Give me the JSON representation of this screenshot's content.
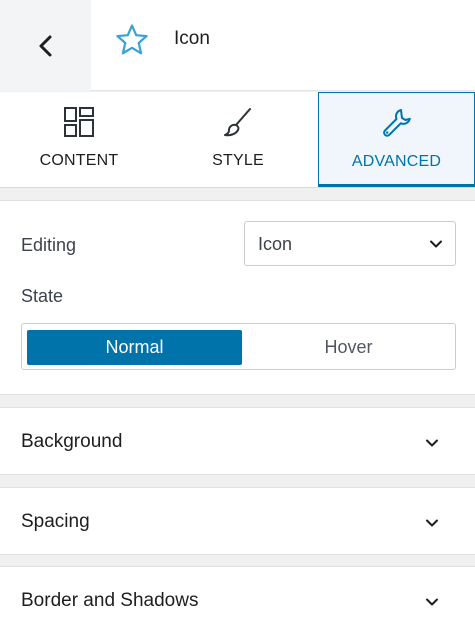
{
  "header": {
    "title": "Icon",
    "back_icon": "chevron-left-icon",
    "block_icon": "star-icon",
    "accent": "#3aa0d8"
  },
  "tabs": [
    {
      "label": "CONTENT",
      "icon": "layout-icon",
      "active": false
    },
    {
      "label": "STYLE",
      "icon": "brush-icon",
      "active": false
    },
    {
      "label": "ADVANCED",
      "icon": "wrench-icon",
      "active": true
    }
  ],
  "editing": {
    "label": "Editing",
    "value": "Icon"
  },
  "state": {
    "label": "State",
    "options": [
      "Normal",
      "Hover"
    ],
    "selected": "Normal"
  },
  "sections": [
    {
      "title": "Background"
    },
    {
      "title": "Spacing"
    },
    {
      "title": "Border and Shadows"
    }
  ],
  "colors": {
    "primary": "#0073aa",
    "text": "#1e1e1e"
  }
}
